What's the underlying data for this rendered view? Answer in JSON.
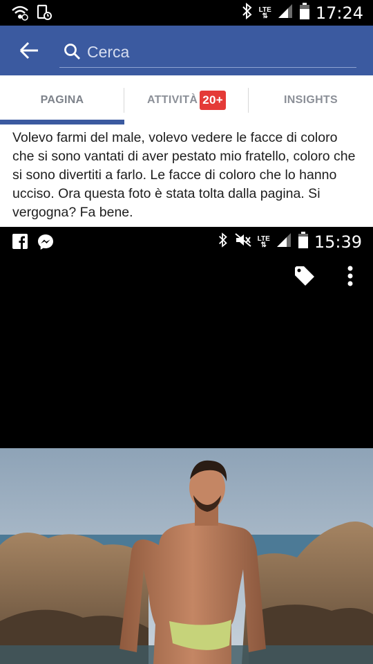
{
  "status_bar": {
    "time": "17:24",
    "network": "LTE",
    "icons": [
      "wifi-icon",
      "screen-mirror-icon",
      "bluetooth-icon",
      "signal-icon",
      "battery-icon"
    ]
  },
  "app_bar": {
    "back_icon": "arrow-left-icon",
    "search_icon": "search-icon",
    "search_placeholder": "Cerca",
    "color": "#3b5aa0"
  },
  "tabs": [
    {
      "label": "PAGINA",
      "selected": true
    },
    {
      "label": "ATTIVITÀ",
      "badge": "20+"
    },
    {
      "label": "INSIGHTS"
    }
  ],
  "post": {
    "text": "Volevo farmi del male, volevo vedere le facce di coloro che si sono vantati di aver pestato mio fratello, coloro che si sono divertiti a farlo. Le facce di coloro che lo hanno ucciso. Ora questa foto è stata tolta dalla pagina. Si vergogna? Fa bene."
  },
  "embedded_screenshot": {
    "time": "15:39",
    "network": "LTE",
    "left_icons": [
      "facebook-icon",
      "messenger-icon"
    ],
    "right_icons": [
      "bluetooth-icon",
      "mute-icon",
      "signal-icon",
      "battery-icon"
    ],
    "action_icons": [
      "tag-icon",
      "more-vertical-icon"
    ]
  }
}
